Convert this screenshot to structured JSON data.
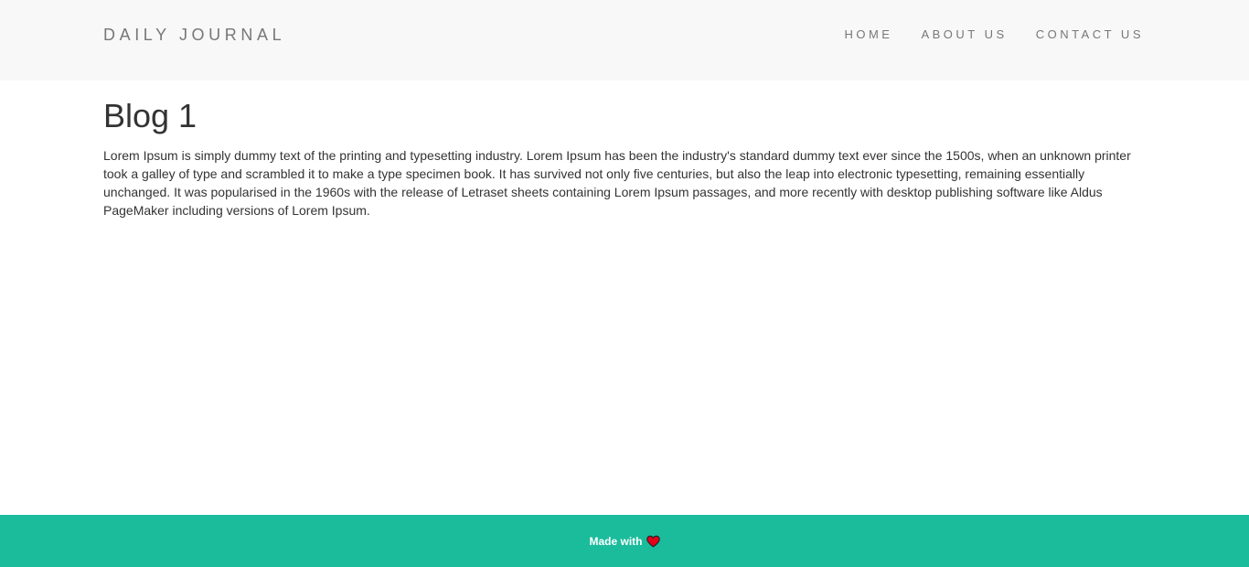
{
  "header": {
    "brand": "DAILY JOURNAL",
    "nav": [
      {
        "label": "HOME"
      },
      {
        "label": "ABOUT US"
      },
      {
        "label": "CONTACT US"
      }
    ]
  },
  "post": {
    "title": "Blog 1",
    "body": "Lorem Ipsum is simply dummy text of the printing and typesetting industry. Lorem Ipsum has been the industry's standard dummy text ever since the 1500s, when an unknown printer took a galley of type and scrambled it to make a type specimen book. It has survived not only five centuries, but also the leap into electronic typesetting, remaining essentially unchanged. It was popularised in the 1960s with the release of Letraset sheets containing Lorem Ipsum passages, and more recently with desktop publishing software like Aldus PageMaker including versions of Lorem Ipsum."
  },
  "footer": {
    "text": "Made with",
    "icon": "heart-icon",
    "background_color": "#1abc9c",
    "icon_color": "#e3001b"
  }
}
